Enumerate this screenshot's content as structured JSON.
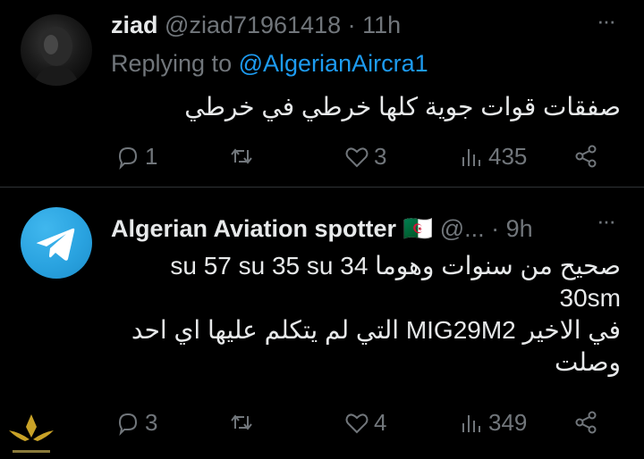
{
  "tweet1": {
    "name": "ziad",
    "handle": "@ziad71961418",
    "separator": "·",
    "time": "11h",
    "replying_prefix": "Replying to",
    "replying_handle": "@AlgerianAircra1",
    "text": "صفقات قوات جوية كلها خرطي في خرطي",
    "stats": {
      "replies": "1",
      "likes": "3",
      "views": "435"
    },
    "more_label": "···"
  },
  "tweet2": {
    "name": "Algerian Aviation spotter",
    "flag": "🇩🇿",
    "handle": "@...",
    "separator": "·",
    "time": "9h",
    "text_lines": [
      "صحيح من سنوات وهوما su 57 su 35 su 34",
      "30sm",
      "في الاخير MIG29M2 التي لم يتكلم عليها اي احد",
      "وصلت"
    ],
    "stats": {
      "replies": "3",
      "likes": "4",
      "views": "349"
    },
    "more_label": "···"
  },
  "colors": {
    "background": "#000000",
    "text": "#e7e9ea",
    "muted": "#71767b",
    "link": "#1d9bf0",
    "divider": "#2f3336",
    "telegram": "#2aa3e0"
  },
  "icons": [
    "reply-icon",
    "retweet-icon",
    "like-icon",
    "views-icon",
    "share-icon",
    "more-icon",
    "telegram-icon",
    "watermark-logo"
  ]
}
